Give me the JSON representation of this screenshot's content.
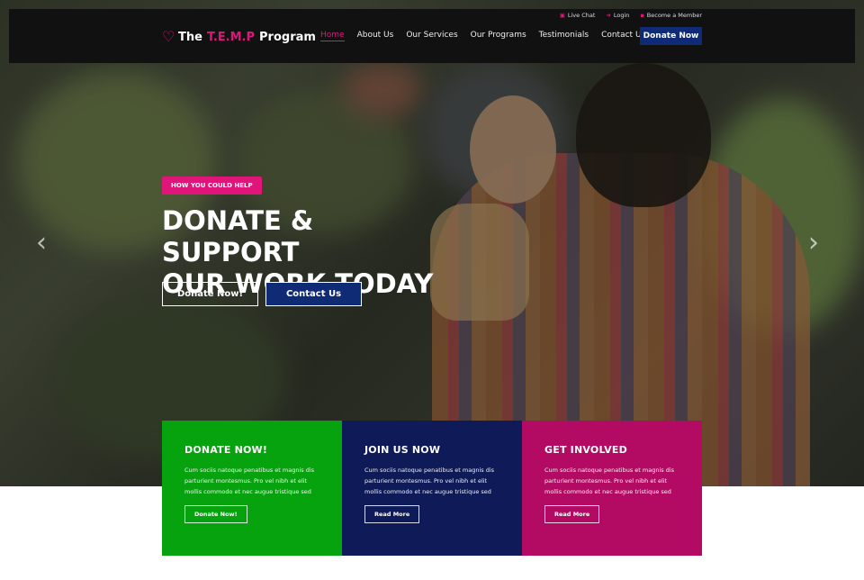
{
  "brand": {
    "name_prefix": "The",
    "name_highlight": "T.E.M.P",
    "name_suffix": "Program",
    "logo_icon": "heart-icon",
    "accent_color": "#e0157a"
  },
  "utility_links": [
    {
      "label": "Live Chat",
      "icon": "chat-icon"
    },
    {
      "label": "Login",
      "icon": "login-icon"
    },
    {
      "label": "Become a Member",
      "icon": "lock-icon"
    }
  ],
  "nav": {
    "items": [
      "Home",
      "About Us",
      "Our Services",
      "Our Programs",
      "Testimonials",
      "Contact Us"
    ],
    "active": "Home",
    "cta_label": "Donate Now",
    "cta_color": "#102b76"
  },
  "hero": {
    "badge": "HOW YOU COULD HELP",
    "headline_line1": "DONATE & SUPPORT",
    "headline_line2": "OUR WORK TODAY",
    "primary_button": "Donate Now!",
    "secondary_button": "Contact Us",
    "prev_icon": "chevron-left-icon",
    "next_icon": "chevron-right-icon"
  },
  "cards": [
    {
      "title": "DONATE NOW!",
      "text": "Cum sociis natoque penatibus et magnis dis parturient montesmus. Pro vel nibh et elit mollis commodo et nec augue tristique sed",
      "button": "Donate Now!",
      "color": "#07a30e"
    },
    {
      "title": "JOIN US NOW",
      "text": "Cum sociis natoque penatibus et magnis dis parturient montesmus. Pro vel nibh et elit mollis commodo et nec augue tristique sed",
      "button": "Read More",
      "color": "#0f1a58"
    },
    {
      "title": "GET INVOLVED",
      "text": "Cum sociis natoque penatibus et magnis dis parturient montesmus. Pro vel nibh et elit mollis commodo et nec augue tristique sed",
      "button": "Read More",
      "color": "#b30b64"
    }
  ]
}
